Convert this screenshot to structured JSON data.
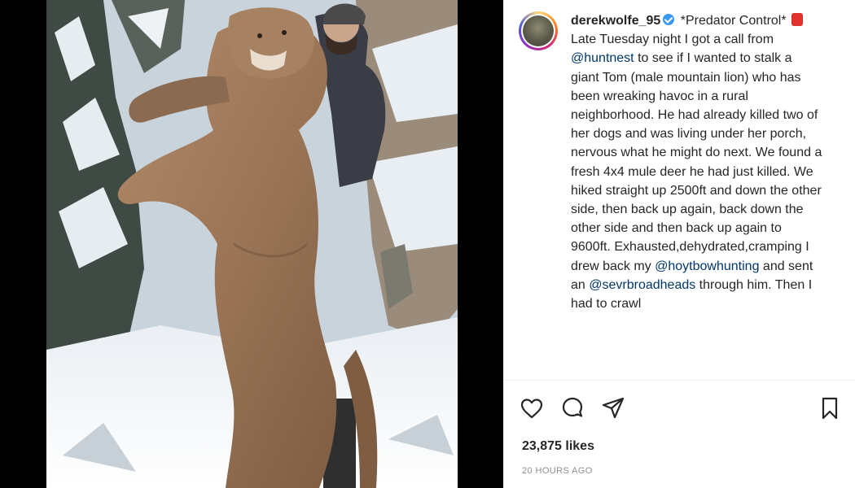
{
  "post": {
    "username": "derekwolfe_95",
    "caption_segments": [
      {
        "type": "text",
        "value": " *Predator Control* "
      },
      {
        "type": "emoji",
        "value": "fire-extinguisher"
      },
      {
        "type": "text",
        "value": " Late Tuesday night I got a call from "
      },
      {
        "type": "mention",
        "value": "@huntnest"
      },
      {
        "type": "text",
        "value": " to see if I wanted to stalk a giant Tom (male mountain lion) who has been wreaking havoc in a rural neighborhood. He had already killed two of her dogs and was living under her porch, nervous what he might do next. We found a fresh 4x4 mule deer he had just killed. We hiked straight up 2500ft and down the other side, then back up again, back down the other side and then back up again to 9600ft. Exhausted,dehydrated,cramping I drew back my "
      },
      {
        "type": "mention",
        "value": "@hoytbowhunting"
      },
      {
        "type": "text",
        "value": " and sent an "
      },
      {
        "type": "mention",
        "value": "@sevrbroadheads"
      },
      {
        "type": "text",
        "value": " through him. Then I had to crawl"
      }
    ],
    "likes": "23,875 likes",
    "time": "20 HOURS AGO"
  },
  "icons": {
    "like": "heart-icon",
    "comment": "comment-icon",
    "share": "paper-plane-icon",
    "save": "bookmark-icon",
    "verified": "verified-badge-icon"
  },
  "colors": {
    "text": "#262626",
    "mention": "#00376b",
    "muted": "#8e8e8e",
    "verified": "#3897f0"
  }
}
